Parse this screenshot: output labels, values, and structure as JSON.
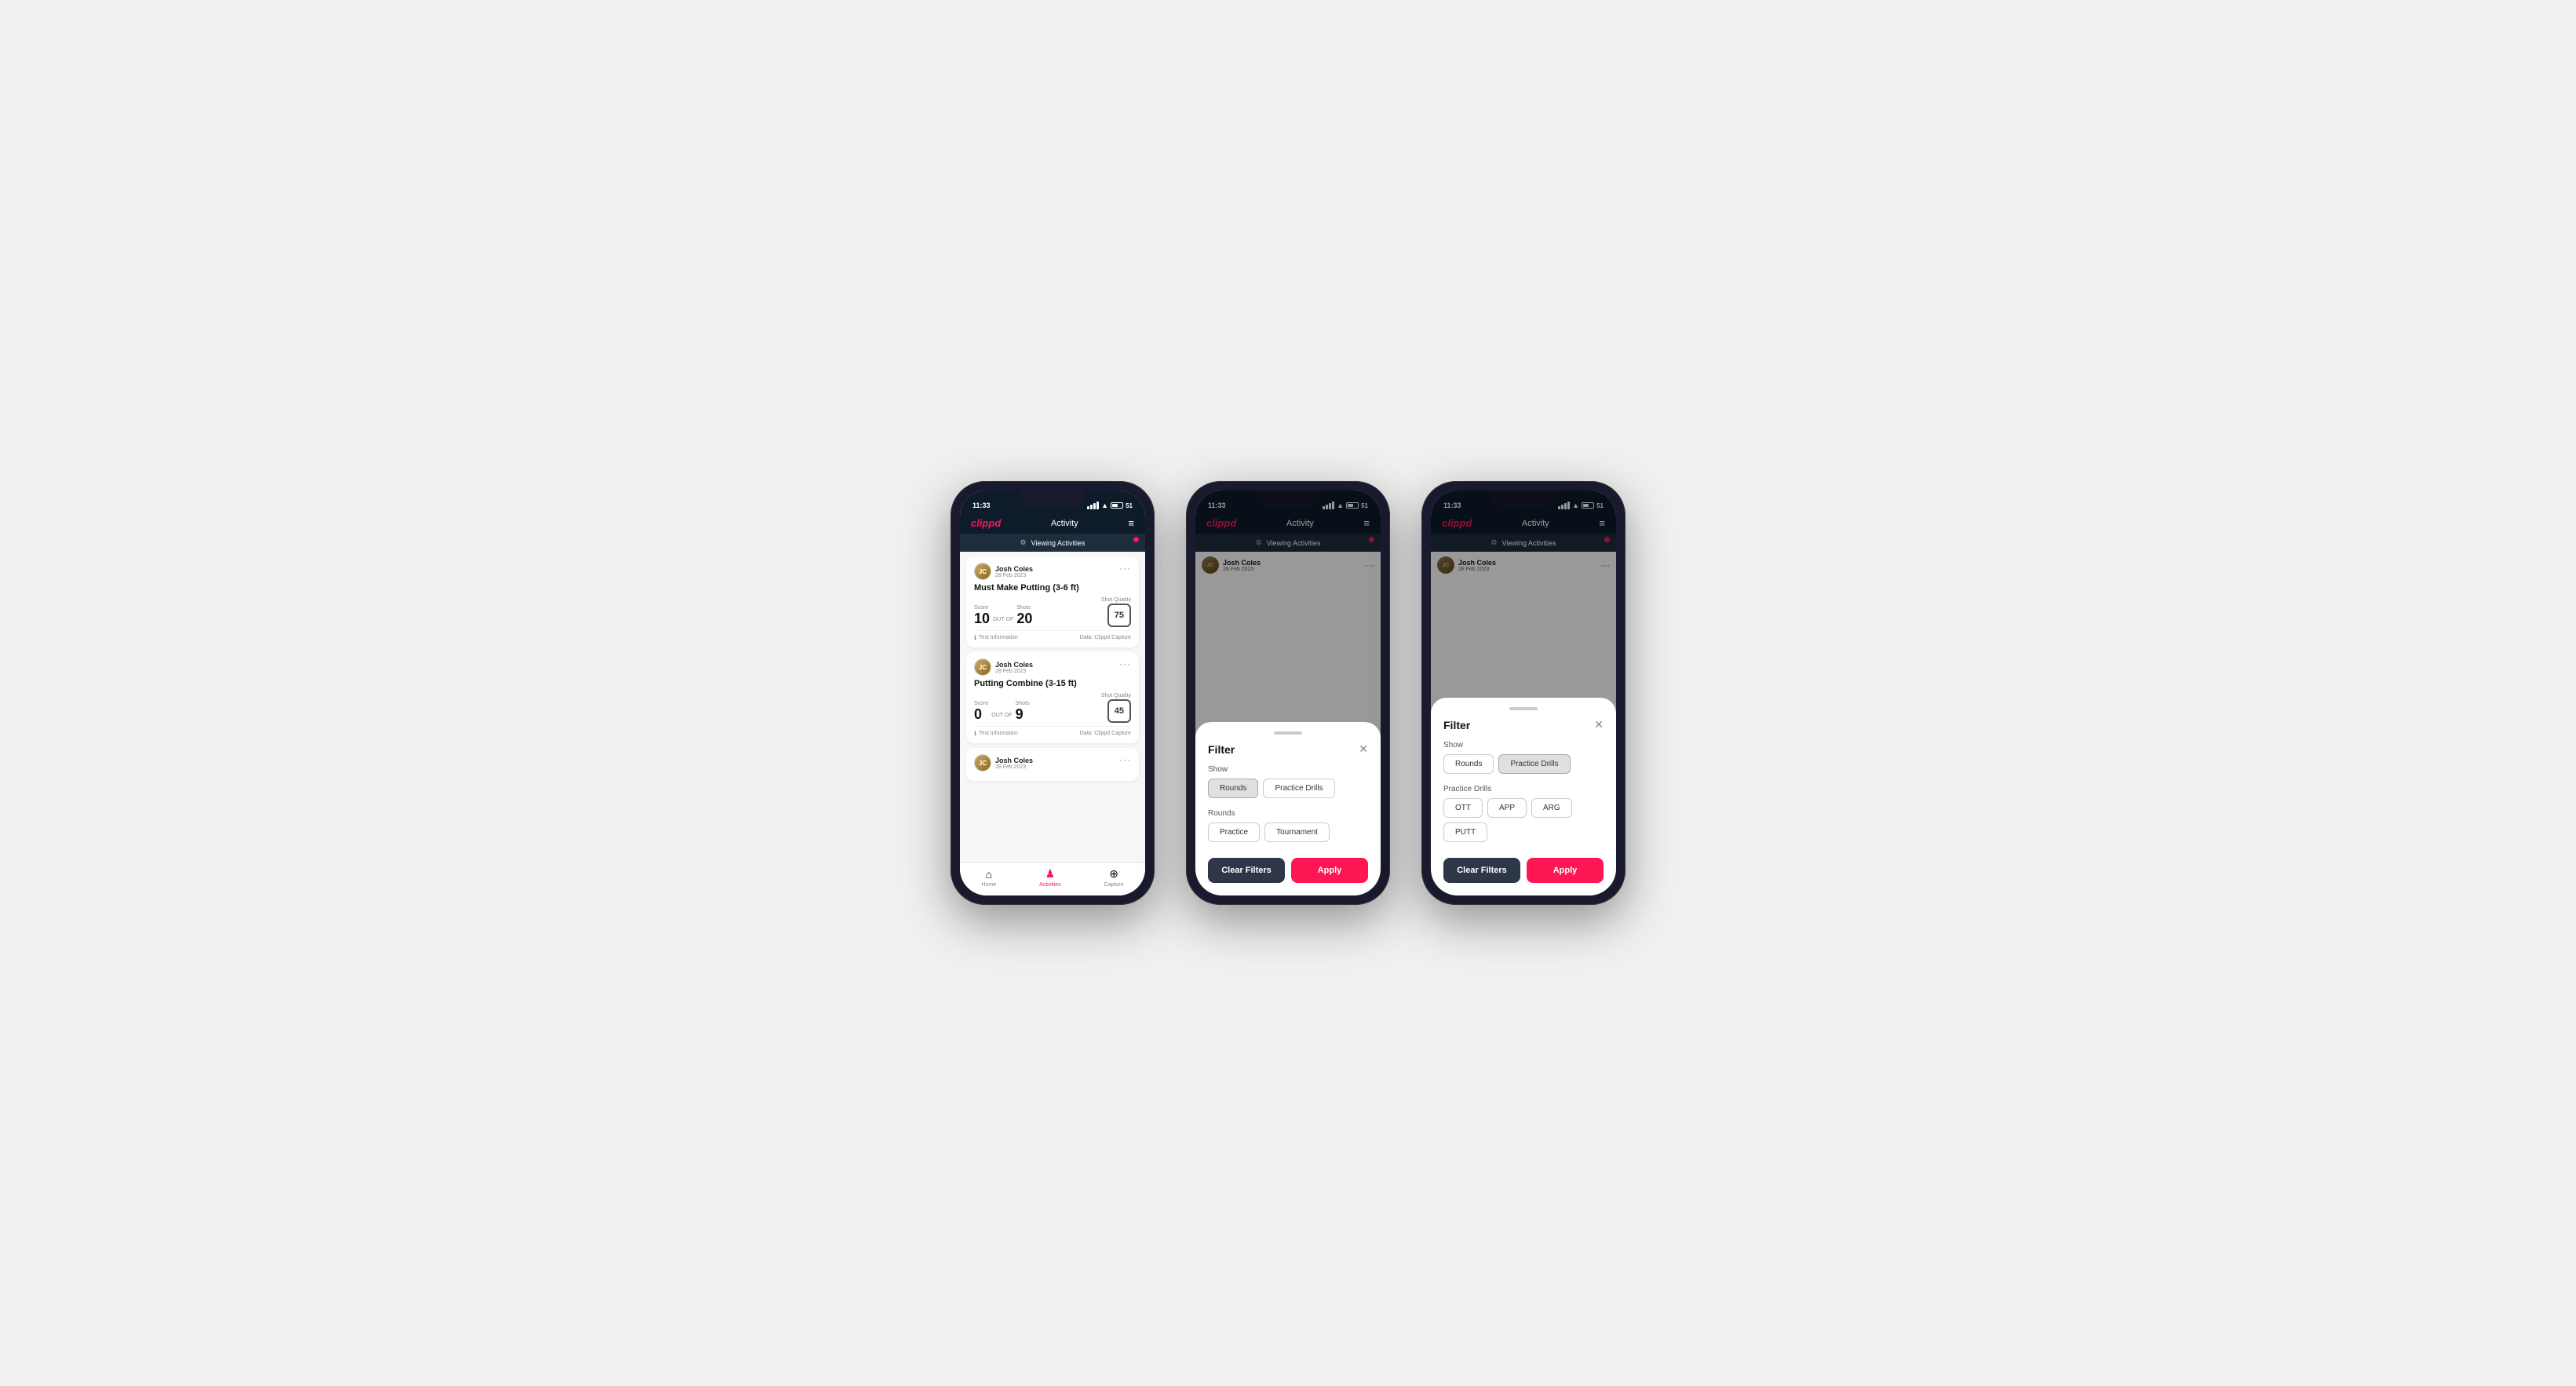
{
  "phones": [
    {
      "id": "phone1",
      "status_bar": {
        "time": "11:33",
        "battery": "51"
      },
      "nav": {
        "logo": "clippd",
        "title": "Activity",
        "menu_icon": "≡"
      },
      "viewing_banner": "Viewing Activities",
      "activities": [
        {
          "user_name": "Josh Coles",
          "user_date": "28 Feb 2023",
          "title": "Must Make Putting (3-6 ft)",
          "score_label": "Score",
          "score_value": "10",
          "out_of_label": "OUT OF",
          "shots_label": "Shots",
          "shots_value": "20",
          "shot_quality_label": "Shot Quality",
          "shot_quality_value": "75",
          "footer_info": "Test Information",
          "footer_data": "Data: Clippd Capture"
        },
        {
          "user_name": "Josh Coles",
          "user_date": "28 Feb 2023",
          "title": "Putting Combine (3-15 ft)",
          "score_label": "Score",
          "score_value": "0",
          "out_of_label": "OUT OF",
          "shots_label": "Shots",
          "shots_value": "9",
          "shot_quality_label": "Shot Quality",
          "shot_quality_value": "45",
          "footer_info": "Test Information",
          "footer_data": "Data: Clippd Capture"
        },
        {
          "user_name": "Josh Coles",
          "user_date": "28 Feb 2023",
          "title": "",
          "score_label": "",
          "score_value": "",
          "out_of_label": "",
          "shots_label": "",
          "shots_value": "",
          "shot_quality_label": "",
          "shot_quality_value": "",
          "footer_info": "",
          "footer_data": ""
        }
      ],
      "tabs": [
        {
          "label": "Home",
          "icon": "⌂",
          "active": false
        },
        {
          "label": "Activities",
          "icon": "♟",
          "active": true
        },
        {
          "label": "Capture",
          "icon": "⊕",
          "active": false
        }
      ],
      "show_filter": false
    },
    {
      "id": "phone2",
      "status_bar": {
        "time": "11:33",
        "battery": "51"
      },
      "nav": {
        "logo": "clippd",
        "title": "Activity",
        "menu_icon": "≡"
      },
      "viewing_banner": "Viewing Activities",
      "show_filter": true,
      "filter": {
        "title": "Filter",
        "show_label": "Show",
        "show_options": [
          {
            "label": "Rounds",
            "active": true
          },
          {
            "label": "Practice Drills",
            "active": false
          }
        ],
        "rounds_label": "Rounds",
        "rounds_options": [
          {
            "label": "Practice",
            "active": false
          },
          {
            "label": "Tournament",
            "active": false
          }
        ],
        "practice_drills_label": null,
        "practice_drills_options": null,
        "clear_label": "Clear Filters",
        "apply_label": "Apply"
      }
    },
    {
      "id": "phone3",
      "status_bar": {
        "time": "11:33",
        "battery": "51"
      },
      "nav": {
        "logo": "clippd",
        "title": "Activity",
        "menu_icon": "≡"
      },
      "viewing_banner": "Viewing Activities",
      "show_filter": true,
      "filter": {
        "title": "Filter",
        "show_label": "Show",
        "show_options": [
          {
            "label": "Rounds",
            "active": false
          },
          {
            "label": "Practice Drills",
            "active": true
          }
        ],
        "rounds_label": null,
        "rounds_options": null,
        "practice_drills_label": "Practice Drills",
        "practice_drills_options": [
          {
            "label": "OTT",
            "active": false
          },
          {
            "label": "APP",
            "active": false
          },
          {
            "label": "ARG",
            "active": false
          },
          {
            "label": "PUTT",
            "active": false
          }
        ],
        "clear_label": "Clear Filters",
        "apply_label": "Apply"
      }
    }
  ]
}
